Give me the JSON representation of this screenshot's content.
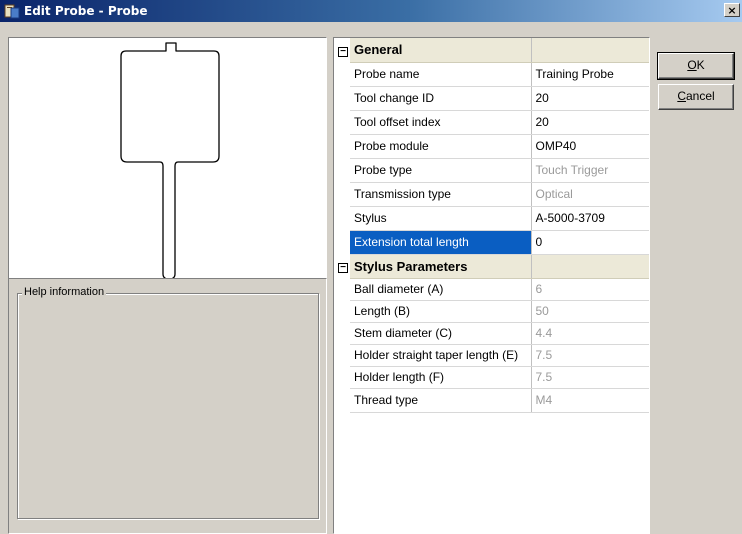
{
  "window": {
    "title": "Edit Probe - Probe",
    "close_label": "×"
  },
  "help": {
    "legend": "Help information",
    "text": ""
  },
  "buttons": {
    "ok": {
      "accel": "O",
      "rest": "K"
    },
    "cancel": {
      "accel": "C",
      "rest": "ancel"
    }
  },
  "grid": {
    "categories": [
      {
        "label": "General",
        "expander": "−",
        "rows": [
          {
            "name": "Probe name",
            "value": "Training Probe",
            "editable": true
          },
          {
            "name": "Tool change ID",
            "value": "20",
            "editable": true
          },
          {
            "name": "Tool offset index",
            "value": "20",
            "editable": true
          },
          {
            "name": "Probe module",
            "value": "OMP40",
            "editable": true
          },
          {
            "name": "Probe type",
            "value": "Touch Trigger",
            "editable": false
          },
          {
            "name": "Transmission type",
            "value": "Optical",
            "editable": false
          },
          {
            "name": "Stylus",
            "value": "A-5000-3709",
            "editable": true
          },
          {
            "name": "Extension total length",
            "value": "0",
            "editable": true,
            "selected": true
          }
        ]
      },
      {
        "label": "Stylus Parameters",
        "expander": "−",
        "rows": [
          {
            "name": "Ball diameter (A)",
            "value": "6",
            "editable": false
          },
          {
            "name": "Length (B)",
            "value": "50",
            "editable": false
          },
          {
            "name": "Stem diameter (C)",
            "value": "4.4",
            "editable": false
          },
          {
            "name": "Holder straight taper length (E)",
            "value": "7.5",
            "editable": false
          },
          {
            "name": "Holder length (F)",
            "value": "7.5",
            "editable": false
          },
          {
            "name": "Thread type",
            "value": "M4",
            "editable": false
          }
        ]
      }
    ]
  },
  "colors": {
    "titlebar_start": "#0a246a",
    "titlebar_end": "#a6caf0",
    "selection": "#0a5ec2",
    "dialog_face": "#d4d0c8",
    "disabled_text": "#9a9a9a"
  }
}
